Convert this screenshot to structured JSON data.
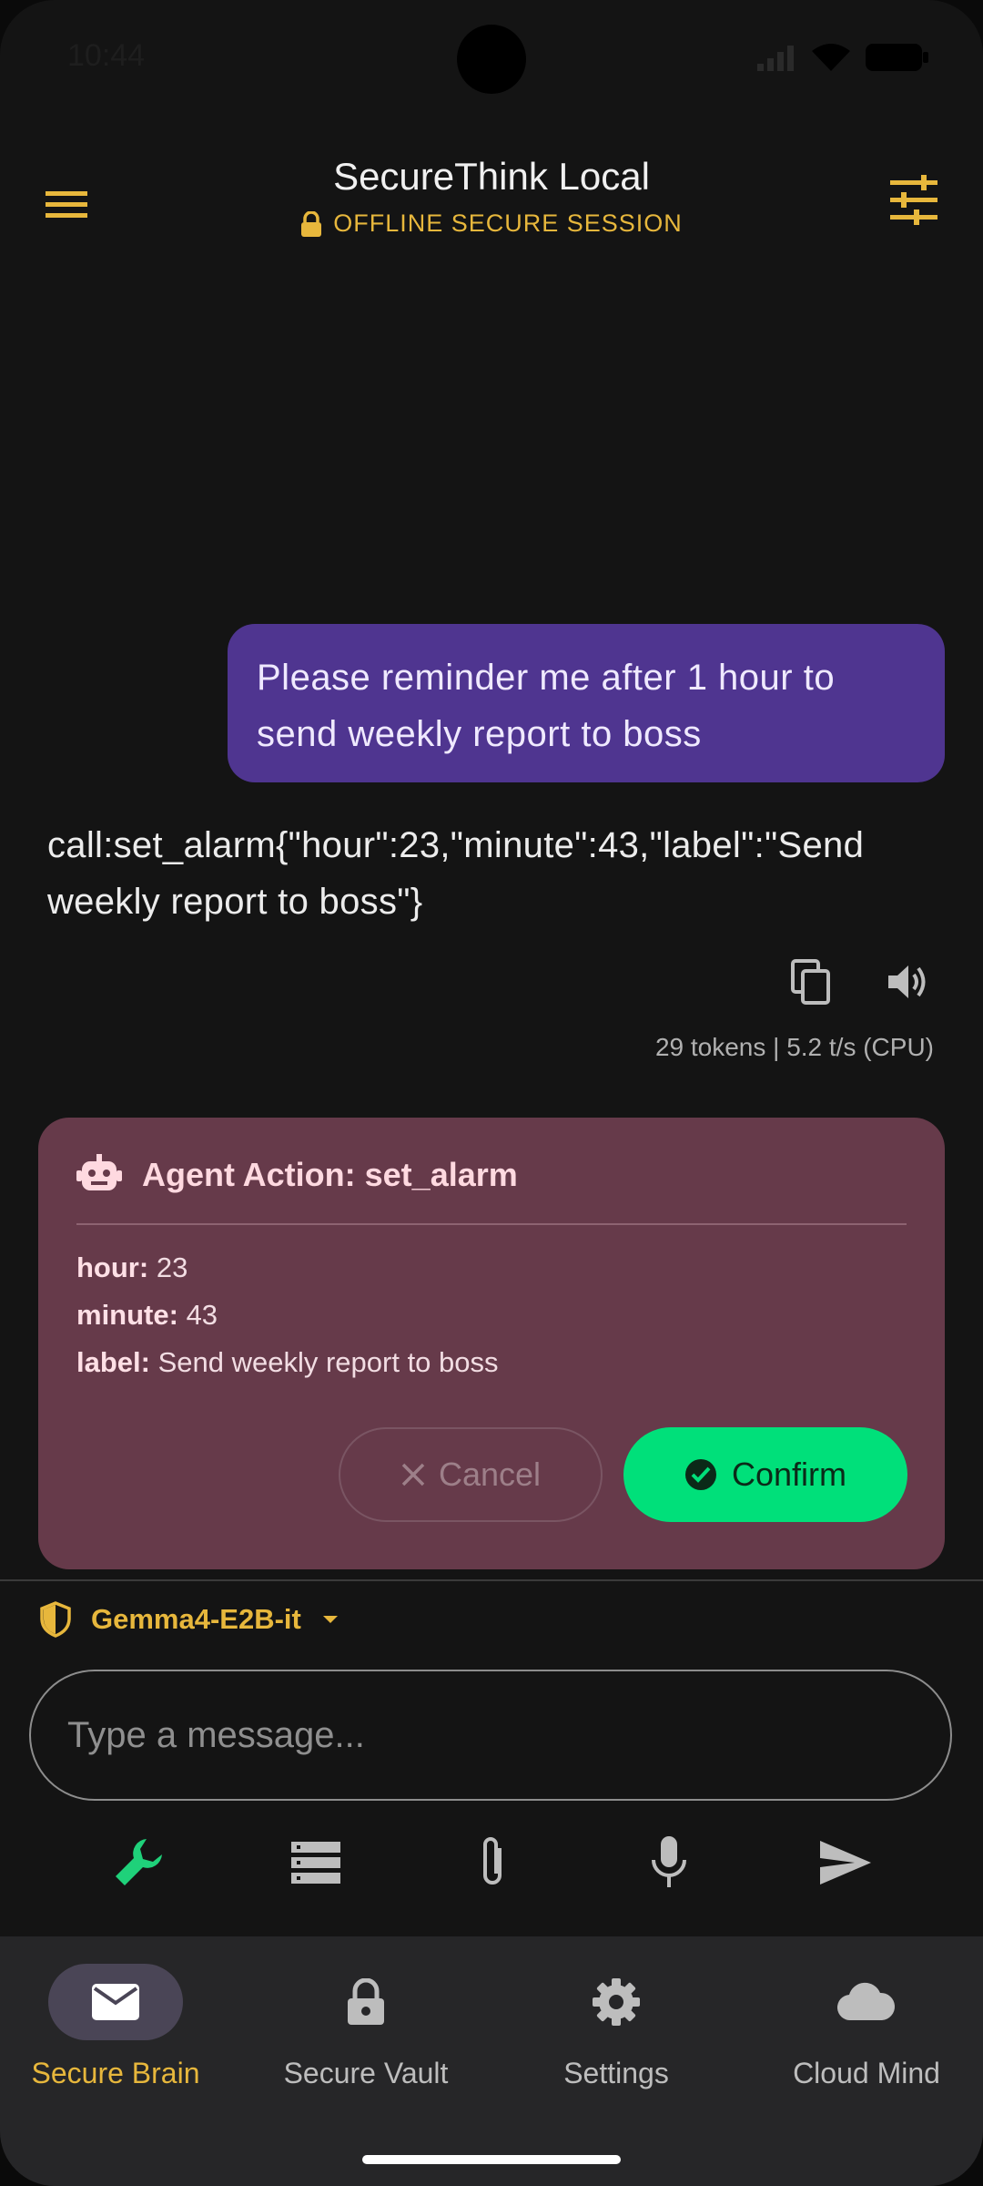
{
  "status_bar": {
    "time": "10:44"
  },
  "header": {
    "title": "SecureThink Local",
    "subtitle": "OFFLINE SECURE SESSION"
  },
  "chat": {
    "user_message": "Please reminder me after 1 hour to send weekly report to boss",
    "agent_message": "call:set_alarm{\"hour\":23,\"minute\":43,\"label\":\"Send weekly report to boss\"}",
    "stats": "29 tokens | 5.2 t/s (CPU)"
  },
  "action_card": {
    "title": "Agent Action: set_alarm",
    "params": [
      {
        "key": "hour:",
        "value": "23"
      },
      {
        "key": "minute:",
        "value": "43"
      },
      {
        "key": "label:",
        "value": "Send weekly report to boss"
      }
    ],
    "cancel_label": "Cancel",
    "confirm_label": "Confirm"
  },
  "composer": {
    "model_name": "Gemma4-E2B-it",
    "placeholder": "Type a message...",
    "tools": [
      "wrench-icon",
      "list-icon",
      "attach-icon",
      "mic-icon",
      "send-icon"
    ]
  },
  "nav": {
    "items": [
      {
        "label": "Secure Brain",
        "icon": "mail-icon",
        "active": true
      },
      {
        "label": "Secure Vault",
        "icon": "lock-icon",
        "active": false
      },
      {
        "label": "Settings",
        "icon": "gear-icon",
        "active": false
      },
      {
        "label": "Cloud Mind",
        "icon": "cloud-icon",
        "active": false
      }
    ]
  },
  "colors": {
    "accent": "#e7b73c",
    "user_bubble": "#4f3590",
    "action_card": "#663a4a",
    "confirm": "#00e07a",
    "active_tool": "#1fd17a"
  }
}
